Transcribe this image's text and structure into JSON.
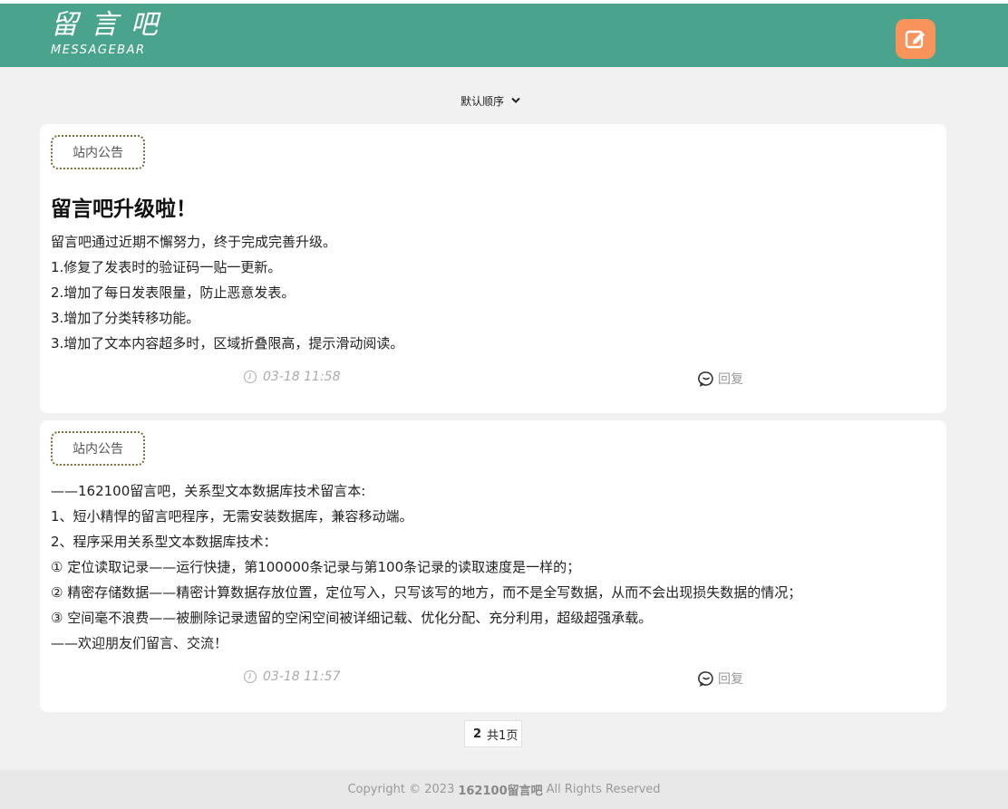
{
  "header": {
    "logo_main": "留言吧",
    "logo_sub": "MESSAGEBAR",
    "write_icon": "edit-icon",
    "accent": "#4aa38c",
    "button_color": "#f9935c"
  },
  "sort": {
    "selected": "默认顺序"
  },
  "posts": [
    {
      "tag": "站内公告",
      "title": "留言吧升级啦！",
      "lines": [
        "留言吧通过近期不懈努力，终于完成完善升级。",
        "1.修复了发表时的验证码一贴一更新。",
        "2.增加了每日发表限量，防止恶意发表。",
        "3.增加了分类转移功能。",
        "3.增加了文本内容超多时，区域折叠限高，提示滑动阅读。"
      ],
      "time": "03-18 11:58",
      "reply": "回复"
    },
    {
      "tag": "站内公告",
      "title": "",
      "lines": [
        "——162100留言吧，关系型文本数据库技术留言本:",
        "1、短小精悍的留言吧程序，无需安装数据库，兼容移动端。",
        "2、程序采用关系型文本数据库技术：",
        "① 定位读取记录——运行快捷，第100000条记录与第100条记录的读取速度是一样的；",
        "② 精密存储数据——精密计算数据存放位置，定位写入，只写该写的地方，而不是全写数据，从而不会出现损失数据的情况；",
        "③ 空间毫不浪费——被删除记录遗留的空闲空间被详细记载、优化分配、充分利用，超级超强承载。",
        "——欢迎朋友们留言、交流！"
      ],
      "time": "03-18 11:57",
      "reply": "回复"
    }
  ],
  "pagination": {
    "current": "2",
    "total": "共1页"
  },
  "footer": {
    "prefix": "Copyright © 2023",
    "site": "162100留言吧",
    "suffix": "All Rights Reserved"
  }
}
